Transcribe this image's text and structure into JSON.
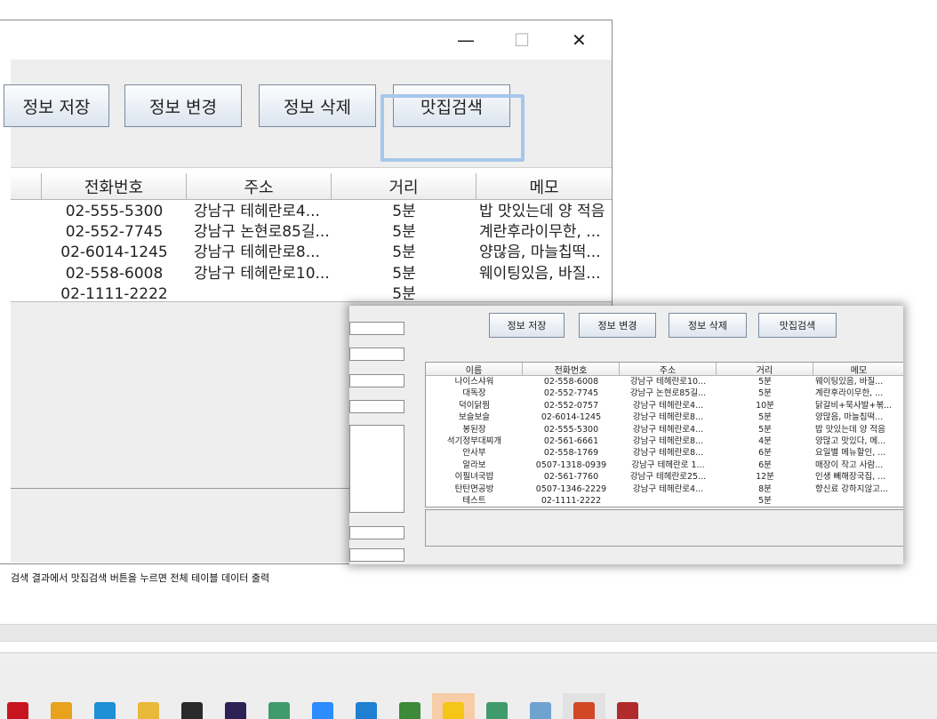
{
  "back_window": {
    "controls": {
      "minimize": "—",
      "maximize": "☐",
      "close": "✕"
    },
    "buttons": [
      "정보 저장",
      "정보 변경",
      "정보 삭제",
      "맛집검색"
    ],
    "table": {
      "columns": [
        "",
        "전화번호",
        "주소",
        "거리",
        "메모"
      ],
      "rows": [
        [
          "02-555-5300",
          "강남구 테헤란로4...",
          "5분",
          "밥 맛있는데 양 적음"
        ],
        [
          "02-552-7745",
          "강남구 논현로85길...",
          "5분",
          "계란후라이무한, ..."
        ],
        [
          "02-6014-1245",
          "강남구 테헤란로8...",
          "5분",
          "양많음, 마늘칩떡..."
        ],
        [
          "02-558-6008",
          "강남구 테헤란로10...",
          "5분",
          "웨이팅있음, 바질..."
        ],
        [
          "02-1111-2222",
          "",
          "5분",
          ""
        ]
      ]
    }
  },
  "front_window": {
    "buttons": [
      "정보 저장",
      "정보 변경",
      "정보 삭제",
      "맛집검색"
    ],
    "table": {
      "columns": [
        "이름",
        "전화번호",
        "주소",
        "거리",
        "메모"
      ],
      "rows": [
        [
          "나이스샤워",
          "02-558-6008",
          "강남구 테헤란로10...",
          "5분",
          "웨이팅있음, 바질..."
        ],
        [
          "대독장",
          "02-552-7745",
          "강남구 논현로85길...",
          "5분",
          "계란후라이무한, ..."
        ],
        [
          "덕이닭찜",
          "02-552-0757",
          "강남구 테헤란로4...",
          "10분",
          "닭갈비+묵사발+볶..."
        ],
        [
          "보슬보슬",
          "02-6014-1245",
          "강남구 테헤란로8...",
          "5분",
          "양많음, 마늘칩떡..."
        ],
        [
          "봉된장",
          "02-555-5300",
          "강남구 테헤란로4...",
          "5분",
          "밥 맛있는데 양 적음"
        ],
        [
          "석기정부대찌개",
          "02-561-6661",
          "강남구 테헤란로8...",
          "4분",
          "양많고 맛있다, 메..."
        ],
        [
          "안사부",
          "02-558-1769",
          "강남구 테헤란로8...",
          "6분",
          "요일별 메뉴할인, ..."
        ],
        [
          "알라보",
          "0507-1318-0939",
          "강남구 테헤란로 1...",
          "6분",
          "매장이 작고 사람..."
        ],
        [
          "이필녀국밥",
          "02-561-7760",
          "강남구 테헤란로25...",
          "12분",
          "인생 빼해장국집, ..."
        ],
        [
          "탄탄면공방",
          "0507-1346-2229",
          "강남구 테헤란로4...",
          "8분",
          "향신료 강하지않고..."
        ],
        [
          "테스트",
          "02-1111-2222",
          "",
          "5분",
          ""
        ]
      ]
    }
  },
  "caption": "검색 결과에서 맛집검색 버튼을 누르면 전체 테이블 데이터 출력",
  "taskbar": {
    "icons": [
      {
        "name": "netflix-icon",
        "color": "#c8141e"
      },
      {
        "name": "chrome-icon",
        "color": "#e8a21d"
      },
      {
        "name": "edge-icon",
        "color": "#1f8fd6"
      },
      {
        "name": "file-explorer-icon",
        "color": "#e9b93a"
      },
      {
        "name": "terminal-icon",
        "color": "#2a2a2a"
      },
      {
        "name": "eclipse-icon",
        "color": "#2c2255"
      },
      {
        "name": "media-player-icon",
        "color": "#3f9b6c"
      },
      {
        "name": "zoom-icon",
        "color": "#2d8cff"
      },
      {
        "name": "vscode-icon",
        "color": "#1f7fd1"
      },
      {
        "name": "node-icon",
        "color": "#3d8a3a"
      },
      {
        "name": "kakaotalk-icon",
        "color": "#f5c518"
      },
      {
        "name": "media-player-2-icon",
        "color": "#3f9b6c"
      },
      {
        "name": "eraser-icon",
        "color": "#6fa3cf"
      },
      {
        "name": "powerpoint-icon",
        "color": "#d24726"
      },
      {
        "name": "winrar-icon",
        "color": "#b02b2b"
      }
    ]
  }
}
